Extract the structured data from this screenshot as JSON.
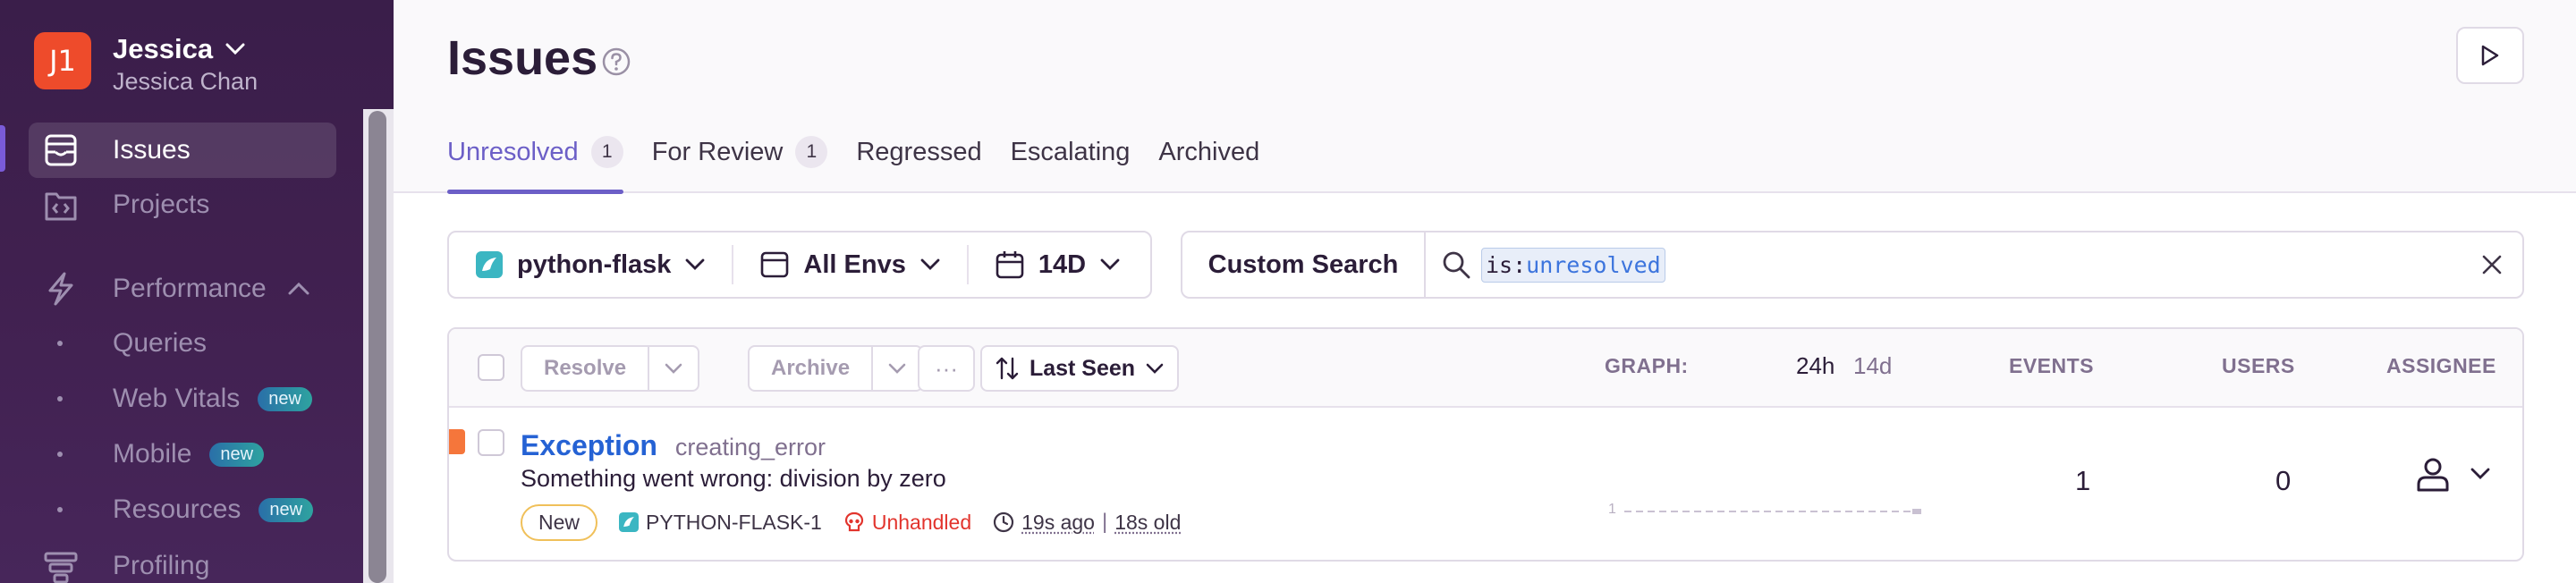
{
  "sidebar": {
    "org": {
      "initials": "J1",
      "name": "Jessica",
      "user": "Jessica Chan"
    },
    "items": [
      {
        "label": "Issues",
        "icon": "issues-icon",
        "active": true
      },
      {
        "label": "Projects",
        "icon": "projects-icon"
      },
      {
        "label": "Performance",
        "icon": "performance-icon",
        "expanded": true
      }
    ],
    "sub_items": [
      {
        "label": "Queries"
      },
      {
        "label": "Web Vitals",
        "badge": "new"
      },
      {
        "label": "Mobile",
        "badge": "new"
      },
      {
        "label": "Resources",
        "badge": "new"
      }
    ],
    "profiling": {
      "label": "Profiling",
      "icon": "profiling-icon"
    }
  },
  "header": {
    "title": "Issues",
    "tabs": [
      {
        "label": "Unresolved",
        "count": "1",
        "active": true
      },
      {
        "label": "For Review",
        "count": "1"
      },
      {
        "label": "Regressed"
      },
      {
        "label": "Escalating"
      },
      {
        "label": "Archived"
      }
    ]
  },
  "filters": {
    "project": "python-flask",
    "environment": "All Envs",
    "period": "14D"
  },
  "search": {
    "custom_label": "Custom Search",
    "token_key": "is:",
    "token_value": "unresolved"
  },
  "table": {
    "actions": {
      "resolve": "Resolve",
      "archive": "Archive",
      "more": "···",
      "sort": "Last Seen"
    },
    "headers": {
      "graph": "GRAPH:",
      "graph_24h": "24h",
      "graph_14d": "14d",
      "events": "EVENTS",
      "users": "USERS",
      "assignee": "ASSIGNEE"
    },
    "rows": [
      {
        "type": "Exception",
        "culprit": "creating_error",
        "message": "Something went wrong: division by zero",
        "status": "New",
        "short_id": "PYTHON-FLASK-1",
        "handled": "Unhandled",
        "last_seen": "19s ago",
        "first_seen": "18s old",
        "spark_max": "1",
        "events": "1",
        "users": "0"
      }
    ]
  },
  "colors": {
    "accent": "#6c5fc7",
    "link": "#2562d4",
    "error": "#e2342d",
    "severity": "#f5763b",
    "org_avatar": "#ee4b2b"
  }
}
